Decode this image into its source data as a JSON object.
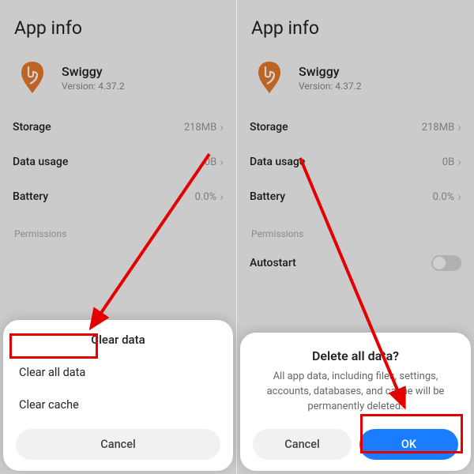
{
  "left": {
    "title": "App info",
    "app": {
      "name": "Swiggy",
      "version": "Version: 4.37.2"
    },
    "rows": {
      "storage": {
        "label": "Storage",
        "value": "218MB"
      },
      "data": {
        "label": "Data usage",
        "value": "0B"
      },
      "battery": {
        "label": "Battery",
        "value": "0.0%"
      }
    },
    "permissions_label": "Permissions",
    "sheet": {
      "title": "Clear data",
      "opt_clear_all": "Clear all data",
      "opt_clear_cache": "Clear cache",
      "cancel": "Cancel"
    }
  },
  "right": {
    "title": "App info",
    "app": {
      "name": "Swiggy",
      "version": "Version: 4.37.2"
    },
    "rows": {
      "storage": {
        "label": "Storage",
        "value": "218MB"
      },
      "data": {
        "label": "Data usage",
        "value": "0B"
      },
      "battery": {
        "label": "Battery",
        "value": "0.0%"
      }
    },
    "permissions_label": "Permissions",
    "autostart_label": "Autostart",
    "sheet": {
      "title": "Delete all data?",
      "body": "All app data, including files, settings, accounts, databases, and cache will be permanently deleted.",
      "cancel": "Cancel",
      "ok": "OK"
    }
  },
  "icon": {
    "kind": "swiggy",
    "color": "#e77a2c"
  }
}
